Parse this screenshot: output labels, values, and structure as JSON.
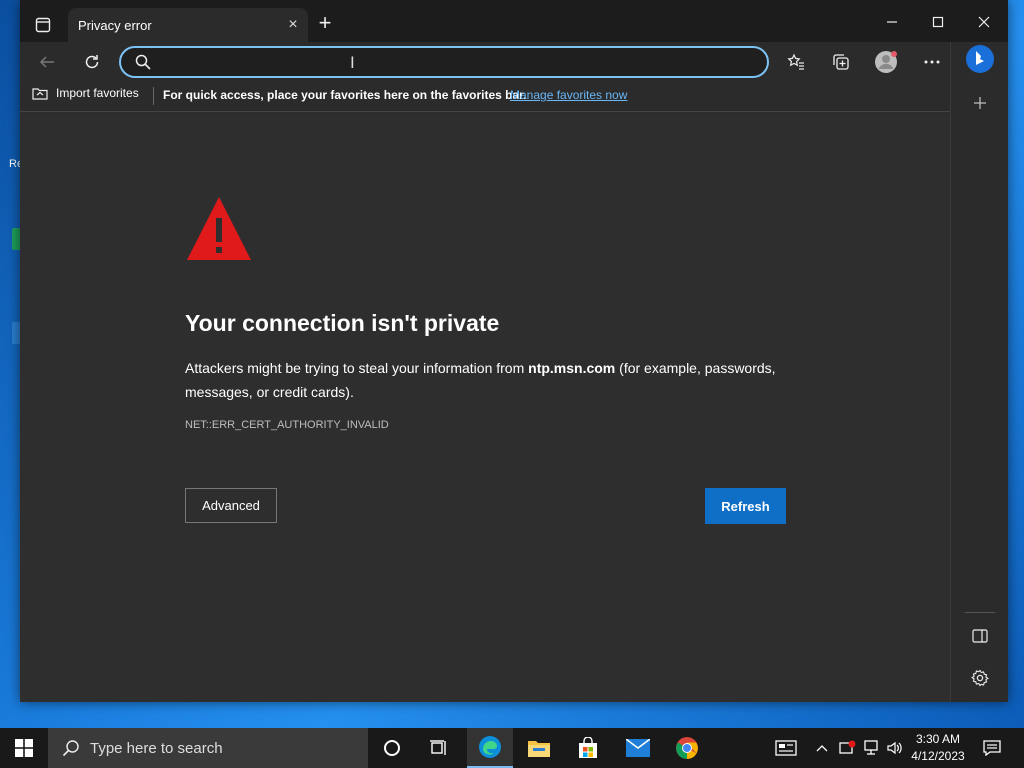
{
  "tab": {
    "title": "Privacy error",
    "close": "×",
    "new_tab": "+"
  },
  "address_bar": {
    "value": "",
    "cursor": "I"
  },
  "favorites_bar": {
    "import_label": "Import favorites",
    "message": "For quick access, place your favorites here on the favorites bar.",
    "link": "Manage favorites now"
  },
  "error_page": {
    "title": "Your connection isn't private",
    "body_prefix": "Attackers might be trying to steal your information from ",
    "host": "ntp.msn.com",
    "body_suffix": " (for example, passwords, messages, or credit cards).",
    "code": "NET::ERR_CERT_AUTHORITY_INVALID",
    "advanced_label": "Advanced",
    "refresh_label": "Refresh"
  },
  "taskbar": {
    "search_placeholder": "Type here to search",
    "time": "3:30 AM",
    "date": "4/12/2023"
  },
  "desktop": {
    "partial_label": "Re"
  },
  "colors": {
    "accent": "#0f6fc6",
    "warning": "#e0191b",
    "link": "#6ab7f7",
    "focus_ring": "#7cc2f5"
  }
}
